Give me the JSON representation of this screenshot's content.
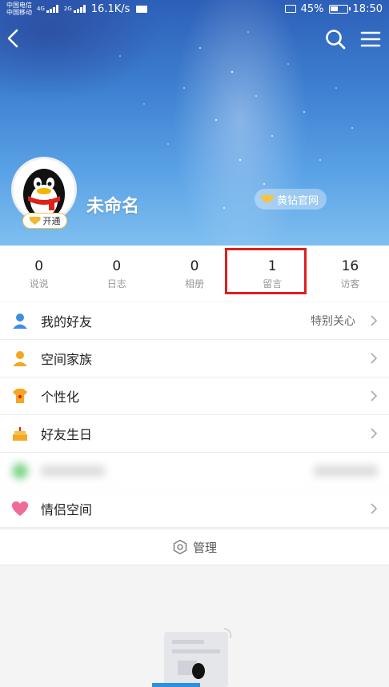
{
  "status_bar": {
    "carrier_1": "中国电信",
    "carrier_2": "中国移动",
    "net_1": "4G",
    "net_2": "2G",
    "speed": "16.1K/s",
    "battery": "45%",
    "time": "18:50"
  },
  "header": {
    "icons": [
      "back-icon",
      "search-icon",
      "menu-icon"
    ],
    "username": "未命名",
    "open_badge": "开通",
    "yellow_diamond_link": "黄钻官网"
  },
  "stats": [
    {
      "value": "0",
      "label": "说说"
    },
    {
      "value": "0",
      "label": "日志"
    },
    {
      "value": "0",
      "label": "相册"
    },
    {
      "value": "1",
      "label": "留言"
    },
    {
      "value": "16",
      "label": "访客"
    }
  ],
  "menu": {
    "items": [
      {
        "label": "我的好友",
        "extra": "特别关心",
        "icon": "friend-icon"
      },
      {
        "label": "空间家族",
        "extra": "",
        "icon": "family-icon"
      },
      {
        "label": "个性化",
        "extra": "",
        "icon": "personalize-icon"
      },
      {
        "label": "好友生日",
        "extra": "",
        "icon": "birthday-cake-icon"
      },
      {
        "label": "情侣空间",
        "extra": "",
        "icon": "heart-icon"
      }
    ],
    "manage_label": "管理"
  },
  "colors": {
    "highlight": "#e01e1e",
    "accent": "#2d8fe0"
  }
}
